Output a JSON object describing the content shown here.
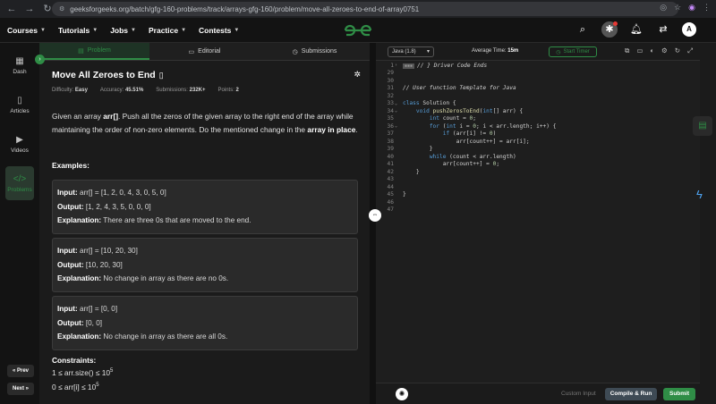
{
  "browser": {
    "url": "geeksforgeeks.org/batch/gfg-160-problems/track/arrays-gfg-160/problem/move-all-zeroes-to-end-of-array0751",
    "profile_initial": "A"
  },
  "topnav": {
    "items": [
      {
        "label": "Courses"
      },
      {
        "label": "Tutorials"
      },
      {
        "label": "Jobs"
      },
      {
        "label": "Practice"
      },
      {
        "label": "Contests"
      }
    ],
    "avatar_initial": "A"
  },
  "sidebar": {
    "items": [
      {
        "label": "Dash",
        "icon": "dashboard-icon"
      },
      {
        "label": "Articles",
        "icon": "book-icon"
      },
      {
        "label": "Videos",
        "icon": "video-icon"
      },
      {
        "label": "Problems",
        "icon": "code-icon"
      }
    ],
    "prev_label": "« Prev",
    "next_label": "Next »"
  },
  "tabs": [
    {
      "label": "Problem",
      "active": true
    },
    {
      "label": "Editorial",
      "active": false
    },
    {
      "label": "Submissions",
      "active": false
    }
  ],
  "problem": {
    "title": "Move All Zeroes to End",
    "difficulty_label": "Difficulty:",
    "difficulty": "Easy",
    "accuracy_label": "Accuracy:",
    "accuracy": "45.51%",
    "submissions_label": "Submissions:",
    "submissions": "232K+",
    "points_label": "Points:",
    "points": "2",
    "desc_1": "Given an array ",
    "desc_arr": "arr[]",
    "desc_2": ". Push all the zeros of the given array to the right end of the array while maintaining the order of non-zero elements. Do the mentioned change in the ",
    "desc_inplace": "array in place",
    "desc_3": ".",
    "examples_label": "Examples:",
    "examples": [
      {
        "input": "arr[] = [1, 2, 0, 4, 3, 0, 5, 0]",
        "output": "[1, 2, 4, 3, 5, 0, 0, 0]",
        "explanation": "There are three 0s that are moved to the end."
      },
      {
        "input": "arr[] = [10, 20, 30]",
        "output": "[10, 20, 30]",
        "explanation": "No change in array as there are no 0s."
      },
      {
        "input": "arr[] = [0, 0]",
        "output": "[0, 0]",
        "explanation": "No change in array as there are all 0s."
      }
    ],
    "input_label": "Input:",
    "output_label": "Output:",
    "explanation_label": "Explanation:",
    "constraints_label": "Constraints:",
    "constraint_1": "1 ≤ arr.size() ≤ 10",
    "constraint_1_exp": "5",
    "constraint_2": "0 ≤ arr[i] ≤ 10",
    "constraint_2_exp": "5"
  },
  "editor": {
    "language": "Java (1.8)",
    "avg_time_label": "Average Time:",
    "avg_time": "15m",
    "timer_label": "Start Timer",
    "custom_input_label": "Custom Input",
    "compile_label": "Compile & Run",
    "submit_label": "Submit",
    "lines": [
      {
        "n": "1",
        "t": "// } Driver Code Ends"
      },
      {
        "n": "29",
        "t": ""
      },
      {
        "n": "30",
        "t": ""
      },
      {
        "n": "31",
        "t": "// User function Template for Java"
      },
      {
        "n": "32",
        "t": ""
      },
      {
        "n": "33",
        "t": "class Solution {"
      },
      {
        "n": "34",
        "t": "    void pushZerosToEnd(int[] arr) {"
      },
      {
        "n": "35",
        "t": "        int count = 0;"
      },
      {
        "n": "36",
        "t": "        for (int i = 0; i < arr.length; i++) {"
      },
      {
        "n": "37",
        "t": "            if (arr[i] != 0)"
      },
      {
        "n": "38",
        "t": "                arr[count++] = arr[i];"
      },
      {
        "n": "39",
        "t": "        }"
      },
      {
        "n": "40",
        "t": "        while (count < arr.length)"
      },
      {
        "n": "41",
        "t": "            arr[count++] = 0;"
      },
      {
        "n": "42",
        "t": "    }"
      },
      {
        "n": "43",
        "t": ""
      },
      {
        "n": "44",
        "t": ""
      },
      {
        "n": "45",
        "t": "}"
      },
      {
        "n": "46",
        "t": ""
      },
      {
        "n": "47",
        "t": ""
      }
    ]
  }
}
